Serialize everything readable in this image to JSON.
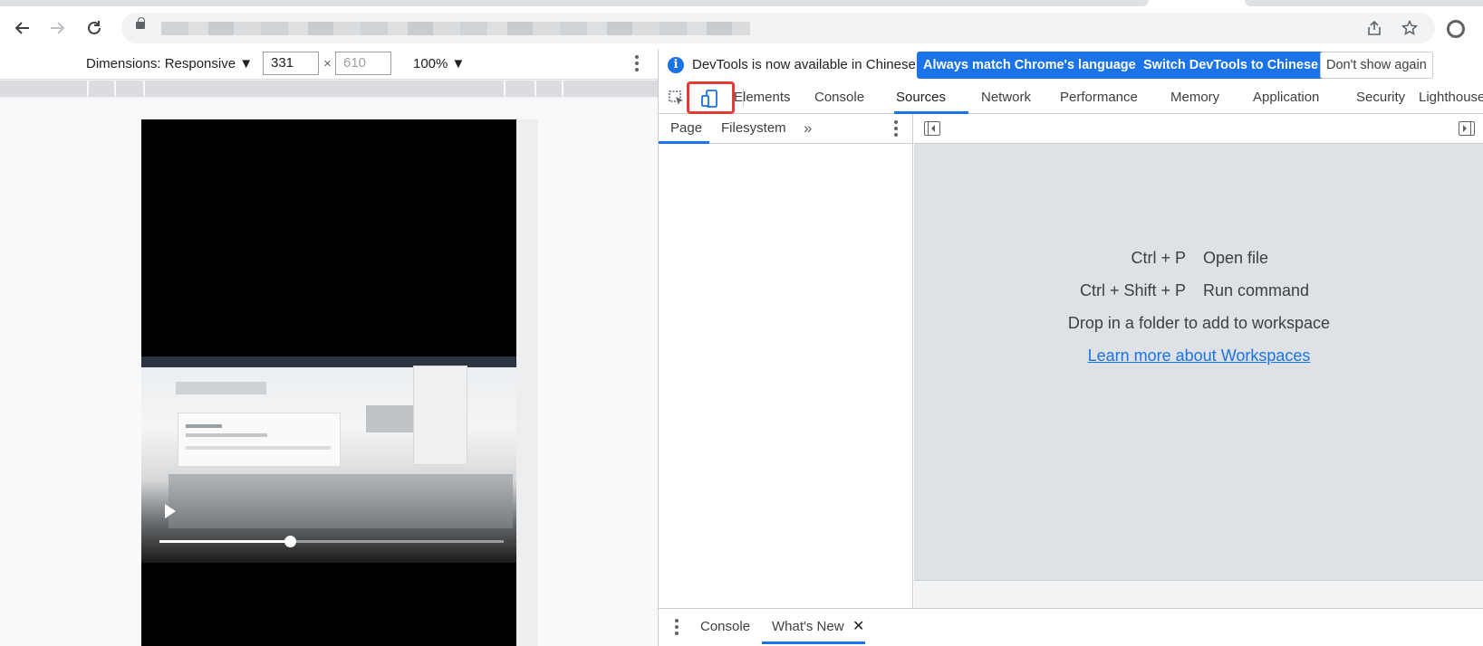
{
  "colors": {
    "accent": "#1a73e8",
    "highlight": "#e53935",
    "editor_bg": "#dee1e6"
  },
  "browser": {
    "icons": [
      "back-arrow-icon",
      "forward-arrow-icon",
      "reload-icon",
      "lock-icon",
      "share-icon",
      "star-icon",
      "profile-icon"
    ]
  },
  "device_toolbar": {
    "dimensions_label": "Dimensions: Responsive ▼",
    "width_value": "331",
    "height_value": "610",
    "separator": "×",
    "zoom_label": "100% ▼",
    "video_progress": 0.38
  },
  "devtools": {
    "infobar": {
      "message": "DevTools is now available in Chinese!",
      "btn_match": "Always match Chrome's language",
      "btn_switch": "Switch DevTools to Chinese",
      "btn_dismiss": "Don't show again"
    },
    "tabs": [
      "Elements",
      "Console",
      "Sources",
      "Network",
      "Performance",
      "Memory",
      "Application",
      "Security",
      "Lighthouse"
    ],
    "active_tab": "Sources",
    "sources": {
      "nav_tabs": [
        "Page",
        "Filesystem"
      ],
      "more": "»",
      "shortcuts": [
        {
          "keys": "Ctrl + P",
          "action": "Open file"
        },
        {
          "keys": "Ctrl + Shift + P",
          "action": "Run command"
        }
      ],
      "drop_text": "Drop in a folder to add to workspace",
      "learn_link": "Learn more about Workspaces"
    },
    "drawer": {
      "tabs": [
        "Console",
        "What's New"
      ],
      "close": "✕"
    }
  }
}
